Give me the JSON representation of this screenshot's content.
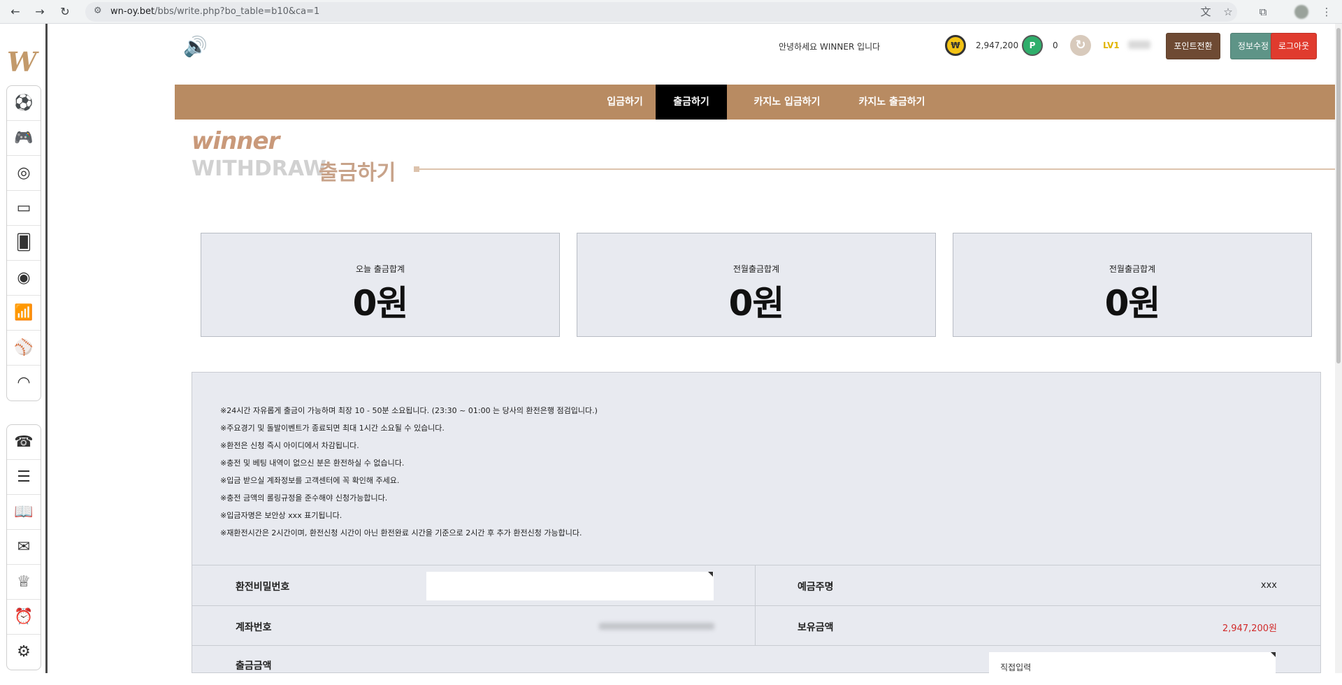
{
  "browser": {
    "url_host": "wn-oy.bet",
    "url_path": "/bbs/write.php?bo_table=b10&ca=1"
  },
  "sidebar": {
    "logo": "W",
    "group1": [
      "soccer-icon",
      "gamepad-icon",
      "roulette-icon",
      "slot-icon",
      "card-icon",
      "target-icon",
      "chart-icon",
      "baseball-icon",
      "wifi-icon"
    ],
    "group2": [
      "support-icon",
      "search-list-icon",
      "book-icon",
      "mail-icon",
      "crown-icon",
      "alarm-icon",
      "settings-icon"
    ]
  },
  "header": {
    "greeting": "안녕하세요 WINNER 입니다",
    "money": "2,947,200",
    "points": "0",
    "level": "LV1",
    "point_convert_label": "포인트전환",
    "info_edit_label": "정보수정",
    "logout_label": "로그아웃"
  },
  "nav": {
    "tabs": [
      {
        "label": "입금하기",
        "active": false
      },
      {
        "label": "출금하기",
        "active": true
      },
      {
        "label": "카지노 입금하기",
        "active": false
      },
      {
        "label": "카지노 출금하기",
        "active": false
      }
    ]
  },
  "title": {
    "brand": "winner",
    "en": "WITHDRAW",
    "ko": "출금하기"
  },
  "summary": [
    {
      "label": "오늘 출금합계",
      "value": "0원"
    },
    {
      "label": "전월출금합계",
      "value": "0원"
    },
    {
      "label": "전월출금합계",
      "value": "0원"
    }
  ],
  "notices": [
    "※24시간 자유롭게 출금이 가능하며 최장 10 - 50분 소요됩니다. (23:30 ~ 01:00 는 당사의 환전은행 점검입니다.)",
    "※주요경기 및 돌발이벤트가 종료되면 최대 1시간 소요될 수 있습니다.",
    "※환전은 신청 즉시 아이디에서 차감됩니다.",
    "※충전 및 베팅 내역이 없으신 분은 환전하실 수 없습니다.",
    "※입금 받으실 계좌정보를 고객센터에 꼭 확인해 주세요.",
    "※충전 금액의 롤링규정을 준수해야 신청가능합니다.",
    "※입금자명은 보안상 xxx 표기됩니다.",
    "※재환전시간은 2시간이며, 환전신청 시간이 아닌 환전완료 시간을 기준으로 2시간 후 추가 환전신청 가능합니다."
  ],
  "form": {
    "password_label": "환전비밀번호",
    "depositor_label": "예금주명",
    "depositor_value": "xxx",
    "account_label": "계좌번호",
    "balance_label": "보유금액",
    "balance_value": "2,947,200원",
    "amount_label": "출금금액",
    "amount_select_value": "직접입력"
  },
  "colors": {
    "nav_bg": "#b88b62",
    "nav_active": "#000000",
    "card_bg": "#e8eaf0",
    "balance_red": "#d12b2b",
    "logout_red": "#e03b2e"
  }
}
